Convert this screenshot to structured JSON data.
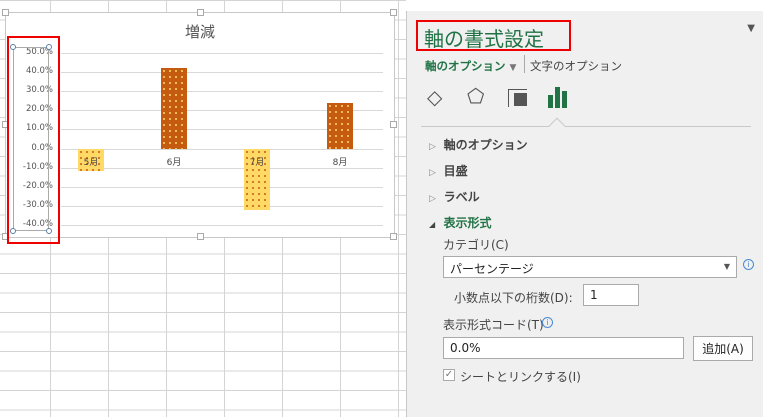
{
  "chart_data": {
    "type": "bar",
    "title": "増減",
    "categories": [
      "5月",
      "6月",
      "7月",
      "8月"
    ],
    "values": [
      -0.12,
      0.42,
      -0.32,
      0.24
    ],
    "ylim": [
      -0.4,
      0.5
    ],
    "yticks": [
      "50.0%",
      "40.0%",
      "30.0%",
      "20.0%",
      "10.0%",
      "0.0%",
      "-10.0%",
      "-20.0%",
      "-30.0%",
      "-40.0%"
    ],
    "colors": {
      "positive": "#c55a11",
      "negative": "#ffd966"
    }
  },
  "panel": {
    "title": "軸の書式設定",
    "tab_axis_options": "軸のオプション",
    "tab_text_options": "文字のオプション",
    "sections": [
      "軸のオプション",
      "目盛",
      "ラベル",
      "表示形式"
    ],
    "category_label": "カテゴリ(C)",
    "category_value": "パーセンテージ",
    "decimals_label": "小数点以下の桁数(D):",
    "decimals_value": "1",
    "format_code_label": "表示形式コード(T)",
    "format_code_value": "0.0%",
    "add_button": "追加(A)",
    "link_label": "シートとリンクする(I)",
    "link_checked": true,
    "icons": [
      "fill-line-icon",
      "effects-icon",
      "size-properties-icon",
      "axis-options-icon"
    ]
  }
}
